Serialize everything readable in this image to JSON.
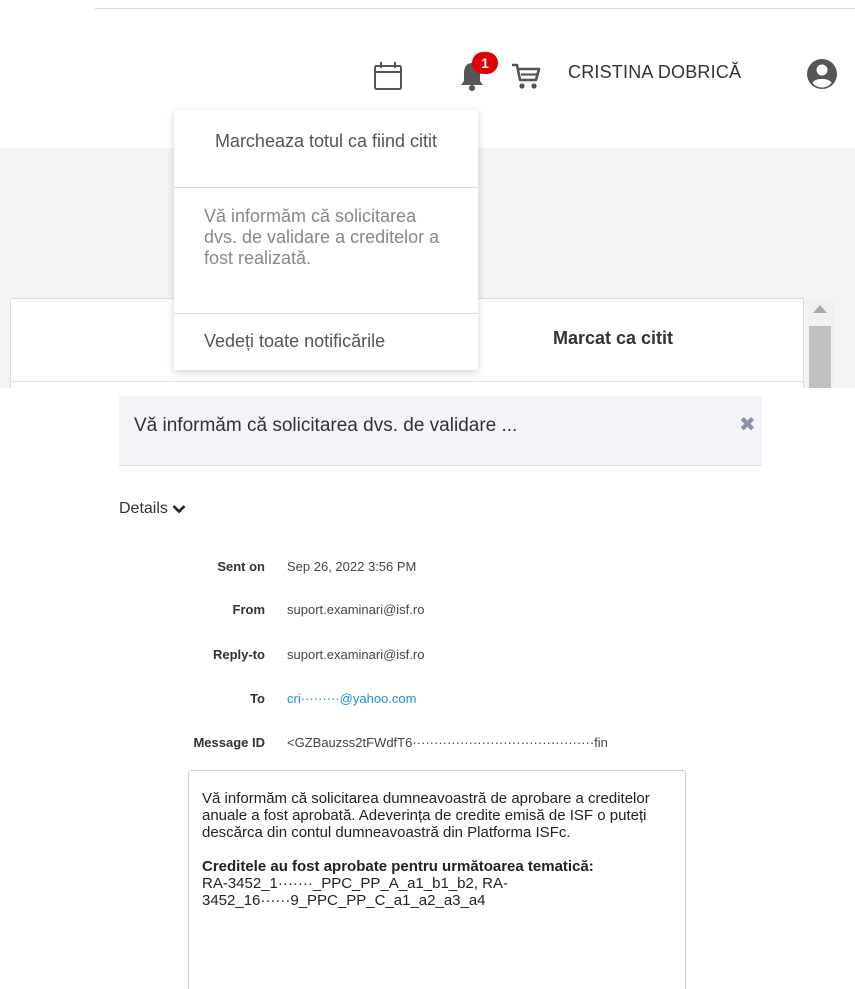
{
  "header": {
    "user_name": "CRISTINA DOBRICĂ",
    "notification_count": "1",
    "icons": [
      "calendar-icon",
      "bell-icon",
      "cart-icon",
      "user-circle-icon"
    ]
  },
  "notifications": {
    "mark_all_label": "Marcheaza totul ca fiind citit",
    "message": "Vă informăm că solicitarea dvs. de validare a creditelor a fost realizată.",
    "see_all_label": "Vedeți toate notificările"
  },
  "panel": {
    "marked_read_label": "Marcat ca citit"
  },
  "email": {
    "subject": "Vă informăm că solicitarea dvs. de validare ...",
    "details_label": "Details",
    "fields": {
      "sent_on": {
        "label": "Sent on",
        "value": "Sep 26, 2022 3:56 PM"
      },
      "from": {
        "label": "From",
        "value": "suport.examinari@isf.ro"
      },
      "reply_to": {
        "label": "Reply-to",
        "value": "suport.examinari@isf.ro"
      },
      "to": {
        "label": "To",
        "value": "cri·········@yahoo.com"
      },
      "message_id": {
        "label": "Message ID",
        "value": "<GZBauzss2tFWdfT6··········································fin"
      }
    },
    "body": {
      "paragraph1": "Vă informăm că solicitarea dumneavoastră de aprobare a creditelor anuale a fost aprobată. Adeverința de credite emisă de ISF o puteți descărca din contul dumneavoastră din Platforma ISFc.",
      "bold_heading": "Creditele au fost aprobate pentru următoarea tematică:",
      "items": "RA-3452_1·······_PPC_PP_A_a1_b1_b2, RA-3452_16······9_PPC_PP_C_a1_a2_a3_a4"
    }
  },
  "colors": {
    "badge": "#e00000",
    "link": "#1a8fe3",
    "header_band": "#f2f4f8"
  }
}
